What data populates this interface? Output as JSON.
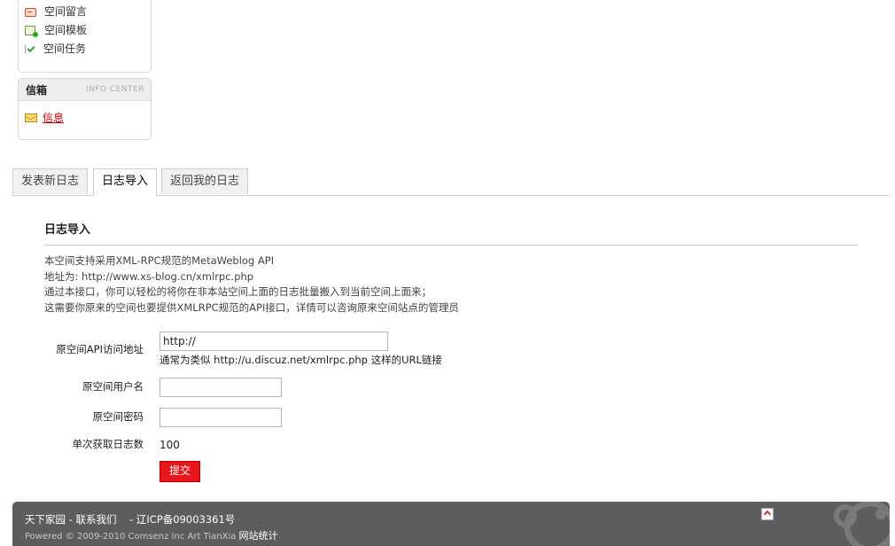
{
  "sidebar": {
    "space_links": [
      {
        "label": "空间留言",
        "icon": "message-icon"
      },
      {
        "label": "空间模板",
        "icon": "template-icon"
      },
      {
        "label": "空间任务",
        "icon": "task-icon"
      }
    ],
    "inbox": {
      "title": "信箱",
      "subtitle": "INFO CENTER",
      "link": "信息",
      "icon": "mail-icon"
    }
  },
  "tabs": [
    {
      "label": "发表新日志"
    },
    {
      "label": "日志导入"
    },
    {
      "label": "返回我的日志"
    }
  ],
  "main": {
    "title": "日志导入",
    "intro": [
      "本空间支持采用XML-RPC规范的MetaWeblog API",
      "地址为: http://www.xs-blog.cn/xmlrpc.php",
      "通过本接口，你可以轻松的将你在非本站空间上面的日志批量搬入到当前空间上面来；",
      "这需要你原来的空间也要提供XMLRPC规范的API接口，详情可以咨询原来空间站点的管理员"
    ],
    "form": {
      "api_label": "原空间API访问地址",
      "api_value": "http://",
      "api_hint": "通常为类似  http://u.discuz.net/xmlrpc.php 这样的URL链接",
      "username_label": "原空间用户名",
      "username_value": "",
      "password_label": "原空间密码",
      "password_value": "",
      "count_label": "单次获取日志数",
      "count_value": "100",
      "submit_label": "提交"
    }
  },
  "footer": {
    "site": "天下家园",
    "contact": "联系我们",
    "icp": "辽ICP备09003361号",
    "stats": "网站统计",
    "powered": "Powered © 2009-2010 Comsenz Inc Art TianXia"
  },
  "colors": {
    "submit_bg": "#e8161b",
    "footer_bg": "#5e5c5e",
    "link_red": "#cc0000"
  }
}
